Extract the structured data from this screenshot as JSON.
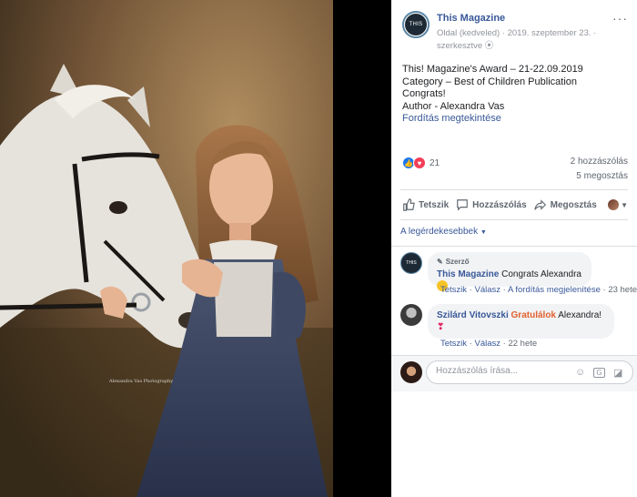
{
  "post": {
    "page_name": "This Magazine",
    "avatar_text": "THIS",
    "meta_line1": "Oldal (kedveled) · 2019. szeptember 23. ·",
    "meta_line2": "szerkesztve",
    "more_icon": "···",
    "text_lines": [
      "This! Magazine's Award – 21-22.09.2019",
      "Category – Best of Children Publication",
      "Congrats!",
      "Author - Alexandra Vas"
    ],
    "translate_link": "Fordítás megtekintése"
  },
  "stats": {
    "reaction_count": "21",
    "comments": "2 hozzászólás",
    "shares": "5 megosztás"
  },
  "actions": {
    "like": "Tetszik",
    "comment": "Hozzászólás",
    "share": "Megosztás"
  },
  "sort_label": "A legérdekesebbek",
  "comments": [
    {
      "author_tag": "Szerző",
      "author": "This Magazine",
      "text": "Congrats Alexandra",
      "actions": [
        "Tetszik",
        "Válasz",
        "A fordítás megjelenítése"
      ],
      "time": "23 hete"
    },
    {
      "author": "Szilárd Vitovszki",
      "highlight": "Gratulálok",
      "text": "Alexandra!",
      "actions": [
        "Tetszik",
        "Válasz"
      ],
      "time": "22 hete"
    }
  ],
  "composer": {
    "placeholder": "Hozzászólás írása..."
  },
  "colors": {
    "link": "#385898",
    "like_blue": "#1877f2",
    "love_red": "#f33e58",
    "highlight_orange": "#e0612e"
  },
  "photo": {
    "watermark": "Alexandra Vas Photography"
  }
}
